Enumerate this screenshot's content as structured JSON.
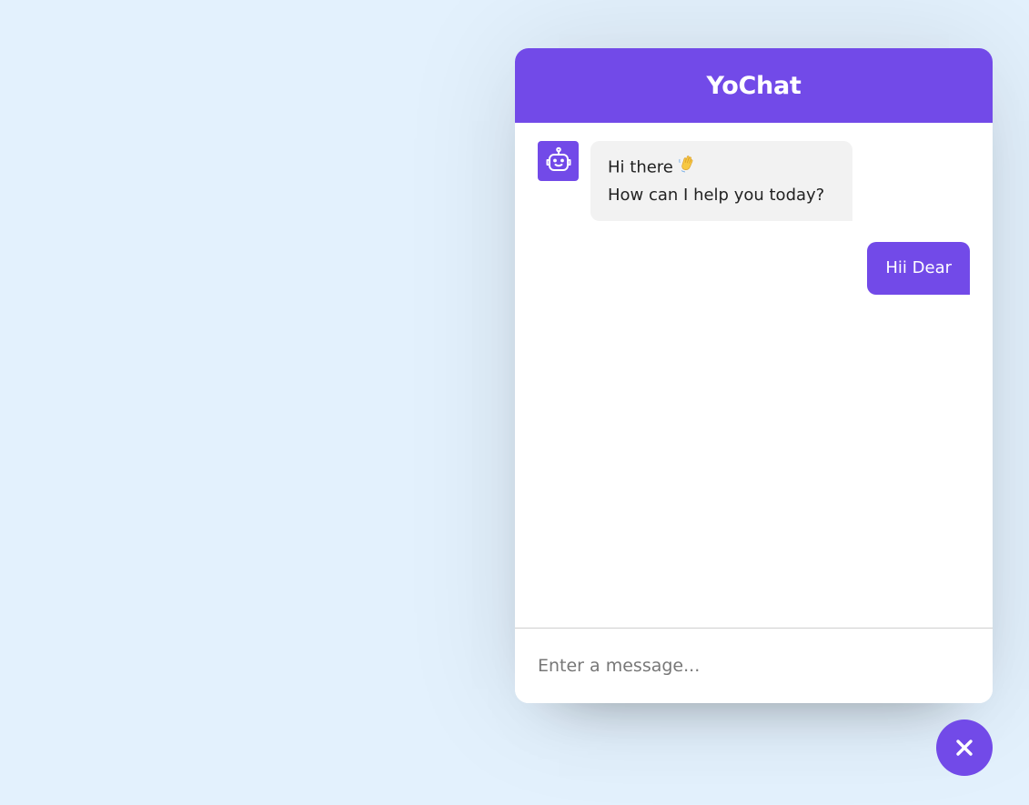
{
  "app": {
    "title": "YoChat",
    "accent_color": "#724ae8"
  },
  "messages": [
    {
      "role": "bot",
      "lines": [
        "Hi there",
        "How can I help you today?"
      ],
      "emoji": "waving-hand",
      "avatar_icon": "robot-icon"
    },
    {
      "role": "user",
      "text": "Hii Dear"
    }
  ],
  "input": {
    "placeholder": "Enter a message..."
  },
  "toggler": {
    "icon": "close-icon"
  }
}
